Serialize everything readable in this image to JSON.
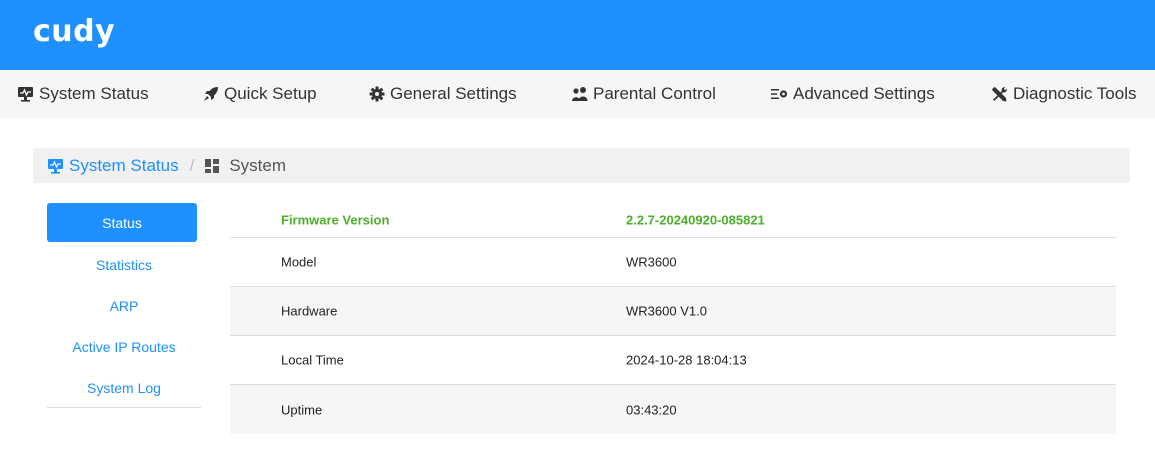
{
  "brand": {
    "logo_text": "cudy",
    "header_color": "#1e90ff"
  },
  "nav": [
    {
      "label": "System Status",
      "icon": "monitor-icon"
    },
    {
      "label": "Quick Setup",
      "icon": "rocket-icon"
    },
    {
      "label": "General Settings",
      "icon": "gear-icon"
    },
    {
      "label": "Parental Control",
      "icon": "users-icon"
    },
    {
      "label": "Advanced Settings",
      "icon": "sliders-icon"
    },
    {
      "label": "Diagnostic Tools",
      "icon": "tools-icon"
    }
  ],
  "breadcrumb": {
    "parent": "System Status",
    "separator": "/",
    "current": "System"
  },
  "sidemenu": [
    {
      "label": "Status",
      "active": true
    },
    {
      "label": "Statistics"
    },
    {
      "label": "ARP"
    },
    {
      "label": "Active IP Routes"
    },
    {
      "label": "System Log"
    }
  ],
  "info": {
    "rows": [
      {
        "label": "Firmware Version",
        "value": "2.2.7-20240920-085821"
      },
      {
        "label": "Model",
        "value": "WR3600"
      },
      {
        "label": "Hardware",
        "value": "WR3600 V1.0"
      },
      {
        "label": "Local Time",
        "value": "2024-10-28 18:04:13"
      },
      {
        "label": "Uptime",
        "value": "03:43:20"
      }
    ]
  },
  "colors": {
    "accent": "#1e90ff",
    "firmware_green": "#4caf2a"
  }
}
